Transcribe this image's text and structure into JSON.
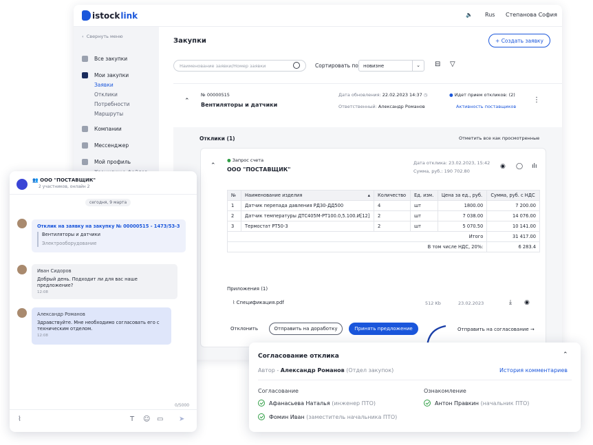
{
  "topbar": {
    "brand_a": "istock",
    "brand_b": "link",
    "lang": "Rus",
    "user": "Степанова София"
  },
  "sidebar": {
    "collapse": "Свернуть меню",
    "items": [
      {
        "label": "Все закупки"
      },
      {
        "label": "Мои закупки",
        "subs": [
          "Заявки",
          "Отклики",
          "Потребности",
          "Маршруты"
        ]
      },
      {
        "label": "Компании"
      },
      {
        "label": "Мессенджер"
      },
      {
        "label": "Мой профиль",
        "subs": [
          "Хранилище файлов"
        ]
      }
    ]
  },
  "main": {
    "title": "Закупки",
    "create_label": "+ Создать заявку",
    "search_placeholder": "Наименование заявки/Номер заявки",
    "sort_label": "Сортировать по",
    "sort_value": "новизне"
  },
  "request": {
    "number": "№ 00000515",
    "title": "Вентиляторы и датчики",
    "updated_label": "Дата обновления:",
    "updated_value": "22.02.2023 14:37",
    "responsible_label": "Ответственный:",
    "responsible_value": "Александр Романов",
    "status": "Идет прием откликов: (2)",
    "activity": "Активность поставщиков"
  },
  "responses": {
    "title": "Отклики (1)",
    "mark_all": "Отметить все как просмотренные",
    "status": "Запрос счета",
    "company": "ООО \"ПОСТАВЩИК\"",
    "date_line": "Дата отклика: 23.02.2023, 15:42",
    "sum_line": "Сумма, руб.: 190 702.80",
    "table": {
      "headers": [
        "№",
        "Наименование изделия",
        "Количество",
        "Ед. изм.",
        "Цена за ед., руб.",
        "Сумма, руб. с НДС"
      ],
      "rows": [
        [
          "1",
          "Датчик перепада давления РД30-ДД500",
          "4",
          "шт",
          "1800.00",
          "7 200.00"
        ],
        [
          "2",
          "Датчик температуры ДТС405М-РТ100.0,5.100.И[12]",
          "2",
          "шт",
          "7 038.00",
          "14 076.00"
        ],
        [
          "3",
          "Термостат РТ50-3",
          "2",
          "шт",
          "5 070.50",
          "10 141.00"
        ]
      ],
      "total_label": "Итого",
      "total_value": "31 417.00",
      "vat_label": "В том числе НДС, 20%:",
      "vat_value": "6 283.4"
    },
    "attachments_title": "Приложения (1)",
    "file_name": "Спецификация.pdf",
    "file_size": "512 Kb",
    "file_date": "23.02.2023",
    "reject": "Отклонить",
    "rework": "Отправить на доработку",
    "accept": "Принять предложение",
    "send_approval": "Отправить на согласование"
  },
  "chat": {
    "title": "ООО \"ПОСТАВЩИК\"",
    "subtitle": "2 участников, онлайн 2",
    "date_chip": "сегодня, 9 марта",
    "msg1": {
      "link": "Отклик на заявку на закупку № 00000515 - 1473/53-3",
      "title": "Вентиляторы и датчики",
      "category": "Электрооборудование"
    },
    "msg2": {
      "author": "Иван Сидоров",
      "text": "Добрый день. Подходит ли для вас наше предложение?",
      "time": "12:08"
    },
    "msg3": {
      "author": "Александр Романов",
      "text": "Здравствуйте. Мне необходимо согласовать его с техническим отделом.",
      "time": "12:08"
    },
    "counter": "0/5000"
  },
  "approval": {
    "title": "Согласование отклика",
    "author_label": "Автор - ",
    "author_name": "Александр Романов",
    "author_dept": "(Отдел закупок)",
    "history": "История комментариев",
    "approve_title": "Согласование",
    "approvers": [
      {
        "name": "Афанасьева Наталья",
        "role": "(инженер ПТО)"
      },
      {
        "name": "Фомин Иван",
        "role": "(заместитель начальника ПТО)"
      }
    ],
    "review_title": "Ознакомление",
    "reviewers": [
      {
        "name": "Антон Правкин",
        "role": "(начальник ПТО)"
      }
    ]
  },
  "colors": {
    "accent": "#1a56db",
    "success": "#2f9e44"
  }
}
